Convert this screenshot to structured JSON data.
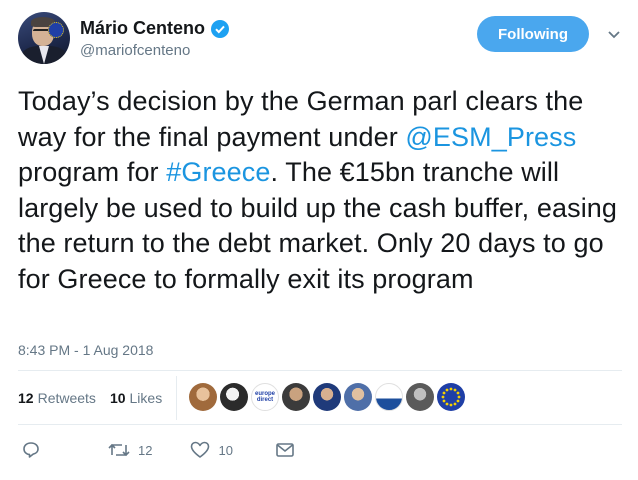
{
  "user": {
    "display_name": "Mário Centeno",
    "handle": "@mariofcenteno",
    "verified": true
  },
  "follow_button": {
    "label": "Following",
    "color": "#4aa7ee"
  },
  "tweet": {
    "text_before_link1": "Today’s decision by the German parl clears the way for the final payment under ",
    "mention": "@ESM_Press",
    "text_between": " program for ",
    "hashtag": "#Greece",
    "text_after": ". The €15bn tranche will largely be used to build up the cash buffer, easing the return to the debt market. Only 20 days to go for Greece to formally exit its program",
    "link_color": "#1b95e0"
  },
  "timestamp": "8:43 PM - 1 Aug 2018",
  "stats": {
    "retweets_count": "12",
    "retweets_label": "Retweets",
    "likes_count": "10",
    "likes_label": "Likes"
  },
  "likers": [
    {
      "icon": "liker-avatar-1-icon"
    },
    {
      "icon": "liker-avatar-2-icon"
    },
    {
      "icon": "liker-avatar-europe-direct-icon",
      "text": "europe direct"
    },
    {
      "icon": "liker-avatar-4-icon"
    },
    {
      "icon": "liker-avatar-5-icon"
    },
    {
      "icon": "liker-avatar-6-icon"
    },
    {
      "icon": "liker-avatar-7-icon"
    },
    {
      "icon": "liker-avatar-8-icon"
    },
    {
      "icon": "liker-avatar-eu-flag-icon"
    }
  ],
  "actions": {
    "reply_icon": "reply-icon",
    "retweet_icon": "retweet-icon",
    "retweet_count": "12",
    "like_icon": "heart-icon",
    "like_count": "10",
    "dm_icon": "envelope-icon"
  }
}
